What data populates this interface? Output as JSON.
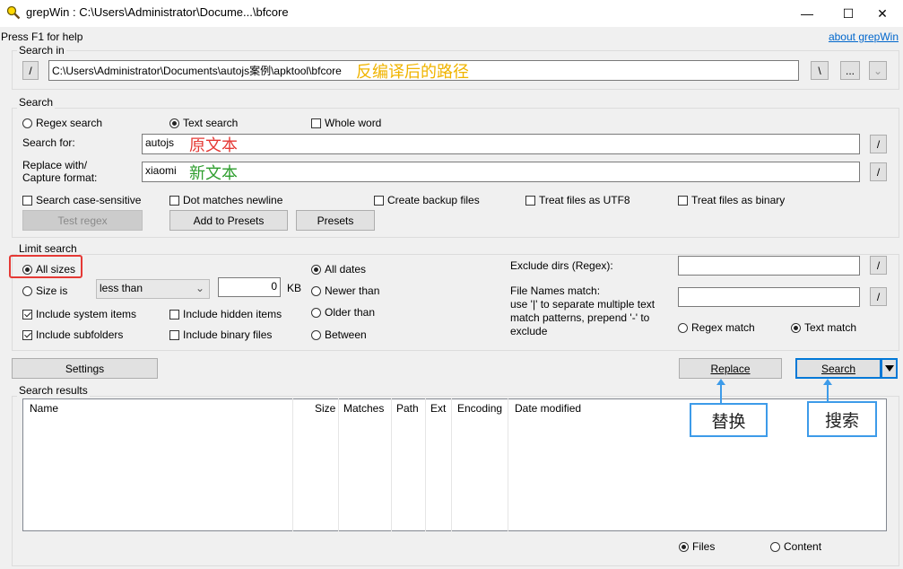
{
  "window": {
    "title": "grepWin : C:\\Users\\Administrator\\Docume...\\bfcore",
    "minimize": "—",
    "maximize": "☐",
    "close": "✕"
  },
  "help": {
    "hint": "Press F1 for help",
    "about_link": "about grepWin"
  },
  "search_in": {
    "group_label": "Search in",
    "toggle_btn": "/",
    "path_value": "C:\\Users\\Administrator\\Documents\\autojs案例\\apktool\\bfcore",
    "backslash_btn": "\\",
    "browse_btn": "...",
    "dropdown_btn": "⌄",
    "annotation": "反编译后的路径"
  },
  "search": {
    "group_label": "Search",
    "regex_label": "Regex search",
    "text_label": "Text search",
    "whole_word_label": "Whole word",
    "search_for_label": "Search for:",
    "search_for_value": "autojs",
    "search_for_annotation": "原文本",
    "replace_label_1": "Replace with/",
    "replace_label_2": "Capture format:",
    "replace_value": "xiaomi",
    "replace_annotation": "新文本",
    "slash_btn": "/",
    "case_sensitive_label": "Search case-sensitive",
    "dot_newline_label": "Dot matches newline",
    "backup_label": "Create backup files",
    "utf8_label": "Treat files as UTF8",
    "binary_label": "Treat files as binary",
    "test_regex_btn": "Test regex",
    "add_presets_btn": "Add to Presets",
    "presets_btn": "Presets"
  },
  "limit": {
    "group_label": "Limit search",
    "all_sizes_label": "All sizes",
    "size_is_label": "Size is",
    "size_op_value": "less than",
    "size_value": "0",
    "size_unit": "KB",
    "system_items_label": "Include system items",
    "hidden_items_label": "Include hidden items",
    "subfolders_label": "Include subfolders",
    "binary_files_label": "Include binary files",
    "all_dates_label": "All dates",
    "newer_label": "Newer than",
    "older_label": "Older than",
    "between_label": "Between",
    "exclude_dirs_label": "Exclude dirs (Regex):",
    "file_names_label_1": "File Names match:",
    "file_names_label_2": "use '|' to separate multiple text",
    "file_names_label_3": "match patterns, prepend '-' to",
    "file_names_label_4": "exclude",
    "regex_match_label": "Regex match",
    "text_match_label": "Text match",
    "slash_btn": "/"
  },
  "actions": {
    "settings_btn": "Settings",
    "replace_btn": "Replace",
    "search_btn": "Search",
    "replace_callout": "替换",
    "search_callout": "搜索"
  },
  "results": {
    "group_label": "Search results",
    "columns": [
      "Name",
      "Size",
      "Matches",
      "Path",
      "Ext",
      "Encoding",
      "Date modified"
    ],
    "files_label": "Files",
    "content_label": "Content"
  },
  "colors": {
    "annotation_path": "#f0b400",
    "annotation_original": "#e53935",
    "annotation_new": "#2e9e2e",
    "callout_border": "#3d9be9",
    "highlight_red": "#e53935"
  }
}
